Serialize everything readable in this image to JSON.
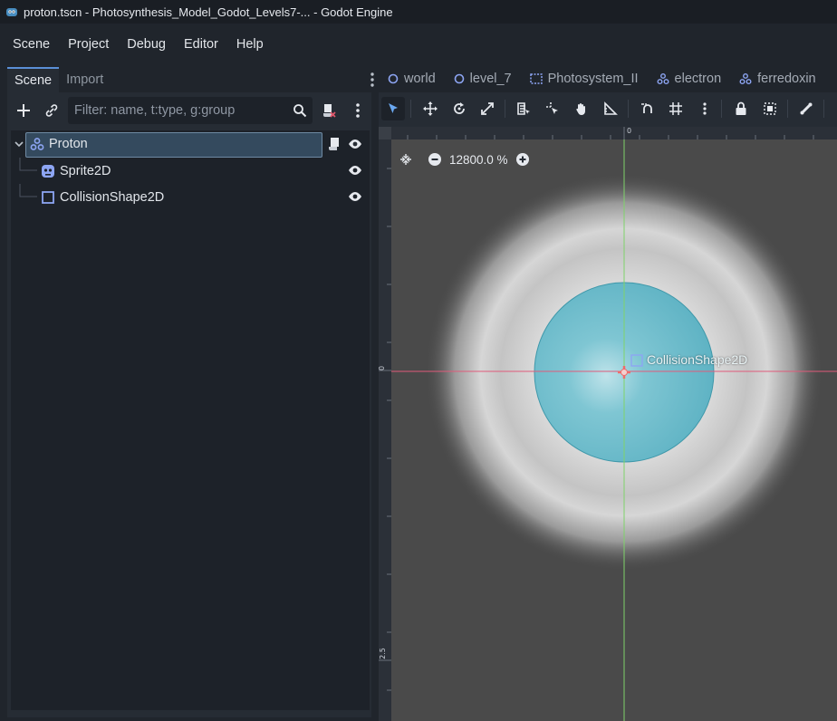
{
  "window": {
    "title": "proton.tscn - Photosynthesis_Model_Godot_Levels7-... - Godot Engine"
  },
  "menu": {
    "items": [
      "Scene",
      "Project",
      "Debug",
      "Editor",
      "Help"
    ]
  },
  "dock": {
    "tabs": [
      "Scene",
      "Import"
    ],
    "active_tab": "Scene",
    "filter_placeholder": "Filter: name, t:type, g:group",
    "tree": [
      {
        "label": "Proton",
        "icon": "rigid-body-node-icon",
        "selected": true,
        "expanded": true,
        "has_script": true,
        "visible": true
      },
      {
        "label": "Sprite2D",
        "icon": "sprite-node-icon",
        "selected": false,
        "visible": true
      },
      {
        "label": "CollisionShape2D",
        "icon": "collision-shape-node-icon",
        "selected": false,
        "visible": true
      }
    ]
  },
  "editor": {
    "scene_tabs": [
      {
        "label": "world",
        "icon": "circle-node-icon"
      },
      {
        "label": "level_7",
        "icon": "circle-node-icon"
      },
      {
        "label": "Photosystem_II",
        "icon": "dashed-rect-node-icon"
      },
      {
        "label": "electron",
        "icon": "rigid-body-node-icon"
      },
      {
        "label": "ferredoxin",
        "icon": "rigid-body-node-icon"
      }
    ],
    "zoom_level": "12800.0 %",
    "ruler": {
      "top_origin_label": "0",
      "left_origin_label": "0",
      "left_lower_label": "2.5"
    },
    "node_label": "CollisionShape2D"
  },
  "colors": {
    "accent": "#5a8fd6",
    "selection": "#344a5e",
    "node_icon": "#8da5f3",
    "collision_shape": "#5fb3c4",
    "x_axis": "#e05a7a",
    "y_axis": "#7fd36a"
  }
}
